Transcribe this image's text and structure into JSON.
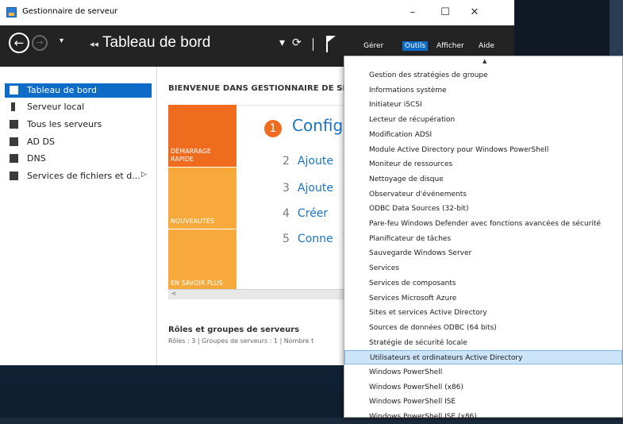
{
  "window": {
    "title": "Gestionnaire de serveur",
    "minimize": "–",
    "maximize": "☐",
    "close": "✕"
  },
  "commandbar": {
    "breadcrumb_arrows": "◂◂",
    "breadcrumb": "Tableau de bord",
    "refresh_icon": "⟳",
    "menus": [
      "Gérer",
      "Outils",
      "Afficher",
      "Aide"
    ],
    "active_menu": "Outils"
  },
  "sidebar": {
    "items": [
      {
        "label": "Tableau de bord",
        "icon": "dashboard-icon",
        "selected": true
      },
      {
        "label": "Serveur local",
        "icon": "server-icon"
      },
      {
        "label": "Tous les serveurs",
        "icon": "servers-icon"
      },
      {
        "label": "AD DS",
        "icon": "adds-icon"
      },
      {
        "label": "DNS",
        "icon": "dns-icon"
      },
      {
        "label": "Services de fichiers et d...",
        "icon": "file-services-icon",
        "has_arrow": true
      }
    ],
    "arrow": "▷"
  },
  "main": {
    "welcome": "BIENVENUE DANS GESTIONNAIRE DE SE",
    "tiles": [
      {
        "label": "DÉMARRAGE RAPIDE",
        "color": "#ef6c1f"
      },
      {
        "label": "NOUVEAUTÉS",
        "color": "#f7a93b"
      },
      {
        "label": "EN SAVOIR PLUS",
        "color": "#f7a93b"
      }
    ],
    "steps": [
      {
        "num": "1",
        "text": "Configu"
      },
      {
        "num": "2",
        "text": "Ajoute"
      },
      {
        "num": "3",
        "text": "Ajoute"
      },
      {
        "num": "4",
        "text": "Créer"
      },
      {
        "num": "5",
        "text": "Conne"
      }
    ],
    "scroll_left": "<",
    "roles_title": "Rôles et groupes de serveurs",
    "roles_sub": "Rôles : 3  |  Groupes de serveurs : 1  |  Nombre t"
  },
  "outils_menu": {
    "items": [
      "Gestion des stratégies de groupe",
      "Informations système",
      "Initiateur iSCSI",
      "Lecteur de récupération",
      "Modification ADSI",
      "Module Active Directory pour Windows PowerShell",
      "Moniteur de ressources",
      "Nettoyage de disque",
      "Observateur d'événements",
      "ODBC Data Sources (32-bit)",
      "Pare-feu Windows Defender avec fonctions avancées de sécurité",
      "Planificateur de tâches",
      "Sauvegarde Windows Server",
      "Services",
      "Services de composants",
      "Services Microsoft Azure",
      "Sites et services Active Directory",
      "Sources de données ODBC (64 bits)",
      "Stratégie de sécurité locale",
      "Utilisateurs et ordinateurs Active Directory",
      "Windows PowerShell",
      "Windows PowerShell (x86)",
      "Windows PowerShell ISE",
      "Windows PowerShell ISE (x86)"
    ],
    "highlighted": "Utilisateurs et ordinateurs Active Directory",
    "scroll_up": "▲"
  },
  "colors": {
    "accent": "#0d6cc8",
    "commandbar": "#232323",
    "highlight": "#cce4f7"
  }
}
